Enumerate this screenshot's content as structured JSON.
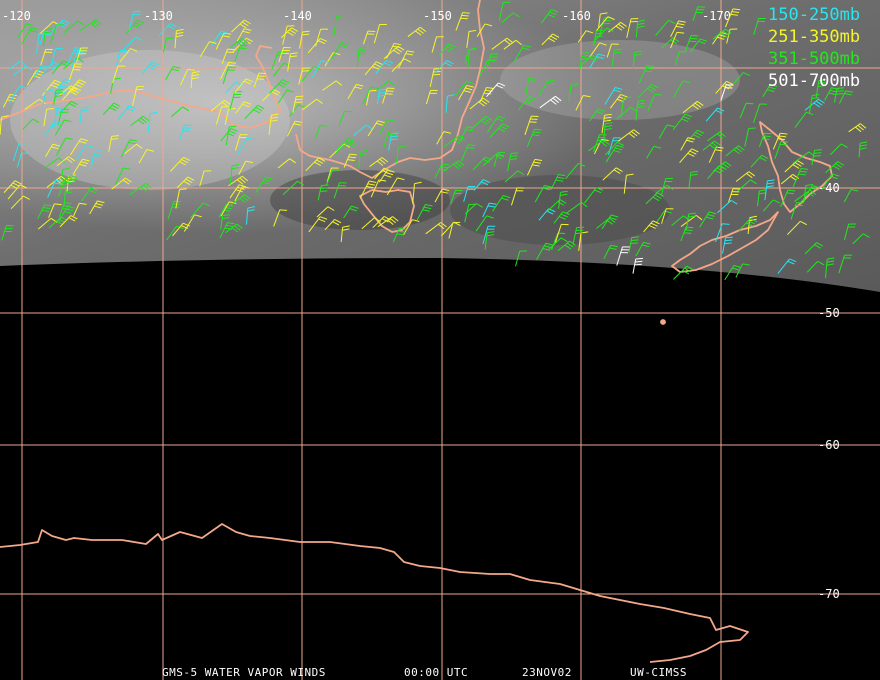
{
  "map": {
    "lon_labels": [
      "-120",
      "-130",
      "-140",
      "-150",
      "-160",
      "-170"
    ],
    "lat_labels": [
      "-40",
      "-50",
      "-60",
      "-70"
    ],
    "colors": {
      "background": "#000000",
      "grid": "#f0a890",
      "coast": "#f4a88a",
      "cloud": "#8a8a8a"
    }
  },
  "legend": [
    {
      "label": "150-250mb",
      "color": "#27e6f0"
    },
    {
      "label": "251-350mb",
      "color": "#f5f52a"
    },
    {
      "label": "351-500mb",
      "color": "#22e61e"
    },
    {
      "label": "501-700mb",
      "color": "#ffffff"
    }
  ],
  "footer": {
    "product": "GMS-5 WATER VAPOR WINDS",
    "time": "00:00 UTC",
    "date": "23NOV02",
    "source": "UW-CIMSS"
  }
}
